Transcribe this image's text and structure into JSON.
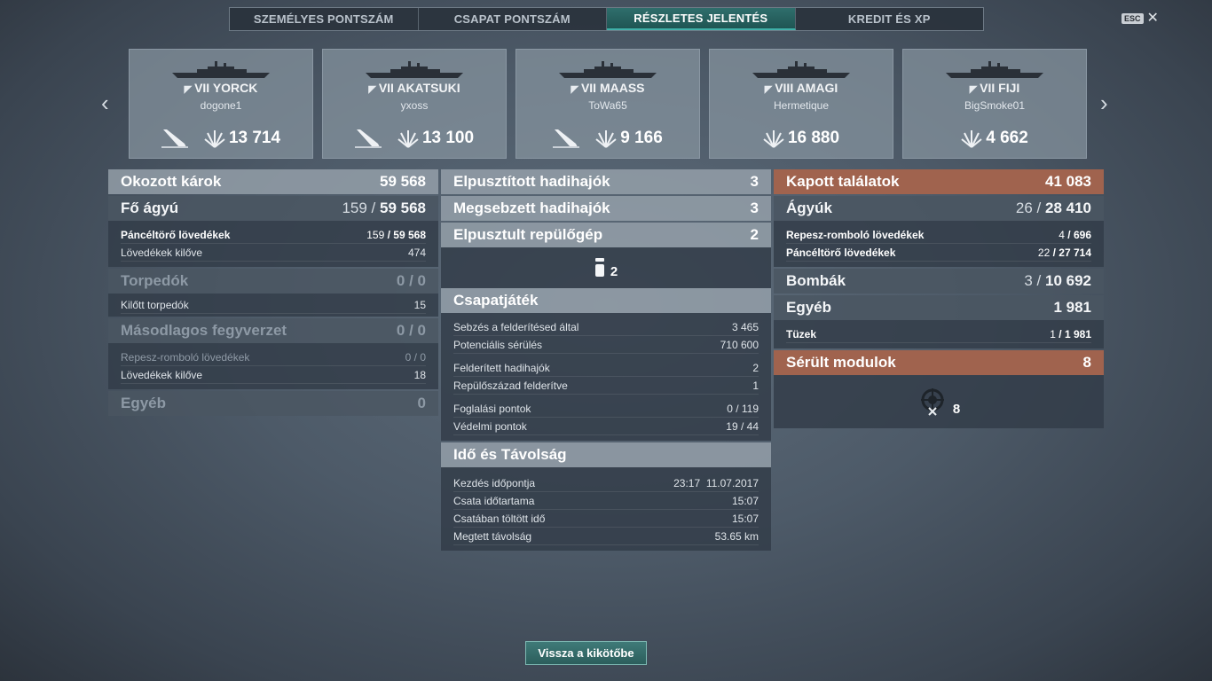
{
  "tabs": [
    "SZEMÉLYES PONTSZÁM",
    "CSAPAT PONTSZÁM",
    "RÉSZLETES JELENTÉS",
    "KREDIT ÉS XP"
  ],
  "active_tab": 2,
  "esc_label": "ESC",
  "close_icon": "close-icon",
  "ships": [
    {
      "tier": "VII",
      "name": "YORCK",
      "player": "dogone1",
      "damage": "13 714",
      "sunk": true,
      "class_icon": "cruiser-icon"
    },
    {
      "tier": "VII",
      "name": "AKATSUKI",
      "player": "yxoss",
      "damage": "13 100",
      "sunk": true,
      "class_icon": "destroyer-icon"
    },
    {
      "tier": "VII",
      "name": "MAASS",
      "player": "ToWa65",
      "damage": "9 166",
      "sunk": true,
      "class_icon": "destroyer-icon"
    },
    {
      "tier": "VIII",
      "name": "AMAGI",
      "player": "Hermetique",
      "damage": "16 880",
      "sunk": false,
      "class_icon": "battleship-icon"
    },
    {
      "tier": "VII",
      "name": "FIJI",
      "player": "BigSmoke01",
      "damage": "4 662",
      "sunk": false,
      "class_icon": "cruiser-icon"
    }
  ],
  "left": {
    "damage_title": "Okozott károk",
    "damage_value": "59 568",
    "main_title": "Fő ágyú",
    "main_hits": "159",
    "main_value": "59 568",
    "ap_label": "Páncéltörő lövedékek",
    "ap_hits": "159",
    "ap_value": "59 568",
    "fired_label": "Lövedékek kilőve",
    "fired_value": "474",
    "torp_title": "Torpedók",
    "torp_value": "0 / 0",
    "torp_fired_label": "Kilőtt torpedók",
    "torp_fired_value": "15",
    "sec_title": "Másodlagos fegyverzet",
    "sec_value": "0 / 0",
    "he_label": "Repesz-romboló lövedékek",
    "he_value": "0 / 0",
    "sec_fired_label": "Lövedékek kilőve",
    "sec_fired_value": "18",
    "other_title": "Egyéb",
    "other_value": "0"
  },
  "middle": {
    "destroyed_label": "Elpusztított hadihajók",
    "destroyed_value": "3",
    "damaged_label": "Megsebzett hadihajók",
    "damaged_value": "3",
    "planes_label": "Elpusztult repülőgép",
    "planes_value": "2",
    "planes_icon_count": "2",
    "team_title": "Csapatjáték",
    "spot_dmg_label": "Sebzés a felderítésed által",
    "spot_dmg_value": "3 465",
    "potential_label": "Potenciális sérülés",
    "potential_value": "710 600",
    "spotted_ships_label": "Felderített hadihajók",
    "spotted_ships_value": "2",
    "spotted_sq_label": "Repülőszázad felderítve",
    "spotted_sq_value": "1",
    "capture_label": "Foglalási pontok",
    "capture_value": "0 / 119",
    "defense_label": "Védelmi pontok",
    "defense_value": "19 / 44",
    "time_title": "Idő és Távolság",
    "start_label": "Kezdés időpontja",
    "start_value": "23:17  11.07.2017",
    "duration_label": "Csata időtartama",
    "duration_value": "15:07",
    "time_in_label": "Csatában töltött idő",
    "time_in_value": "15:07",
    "distance_label": "Megtett távolság",
    "distance_value": "53.65 km"
  },
  "right": {
    "received_title": "Kapott találatok",
    "received_value": "41 083",
    "guns_title": "Ágyúk",
    "guns_hits": "26",
    "guns_value": "28 410",
    "he_label": "Repesz-romboló lövedékek",
    "he_hits": "4",
    "he_value": "696",
    "ap_label": "Páncéltörő lövedékek",
    "ap_hits": "22",
    "ap_value": "27 714",
    "bombs_title": "Bombák",
    "bombs_hits": "3",
    "bombs_value": "10 692",
    "other_title": "Egyéb",
    "other_value": "1 981",
    "fires_label": "Tüzek",
    "fires_hits": "1",
    "fires_value": "1 981",
    "modules_title": "Sérült modulok",
    "modules_value": "8",
    "modules_icon_count": "8"
  },
  "footer": {
    "back_label": "Vissza a kikötőbe"
  },
  "colors": {
    "accent_teal": "#2f6e6c",
    "received_header": "#a0634e"
  }
}
